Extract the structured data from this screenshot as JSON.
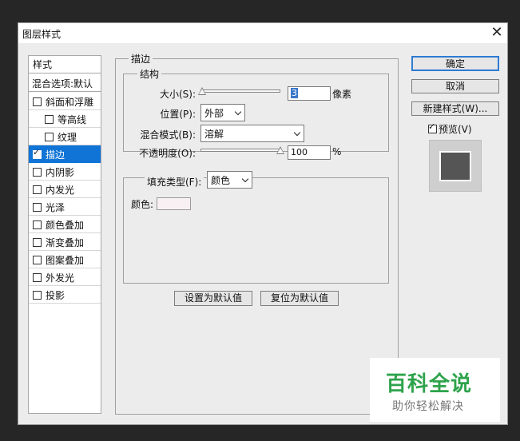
{
  "window": {
    "title": "图层样式",
    "close": "✕"
  },
  "stylelist": {
    "header": "样式",
    "blend_options": "混合选项:默认",
    "items": [
      {
        "label": "斜面和浮雕",
        "checked": false
      },
      {
        "label": "等高线",
        "checked": false
      },
      {
        "label": "纹理",
        "checked": false
      },
      {
        "label": "描边",
        "checked": true
      },
      {
        "label": "内阴影",
        "checked": false
      },
      {
        "label": "内发光",
        "checked": false
      },
      {
        "label": "光泽",
        "checked": false
      },
      {
        "label": "颜色叠加",
        "checked": false
      },
      {
        "label": "渐变叠加",
        "checked": false
      },
      {
        "label": "图案叠加",
        "checked": false
      },
      {
        "label": "外发光",
        "checked": false
      },
      {
        "label": "投影",
        "checked": false
      }
    ],
    "selected": "描边"
  },
  "stroke": {
    "section_title": "描边",
    "structure_title": "结构",
    "size_label": "大小(S):",
    "size_value": "3",
    "size_unit": "像素",
    "size_fraction": 0.02,
    "position_label": "位置(P):",
    "position_value": "外部",
    "blend_label": "混合模式(B):",
    "blend_value": "溶解",
    "opacity_label": "不透明度(O):",
    "opacity_value": "100",
    "opacity_unit": "%",
    "opacity_fraction": 1.0,
    "fill_type_label": "填充类型(F):",
    "fill_type_value": "颜色",
    "color_label": "颜色:",
    "color_value": "#f8f0f2",
    "set_default": "设置为默认值",
    "reset_default": "复位为默认值"
  },
  "buttons": {
    "ok": "确定",
    "cancel": "取消",
    "new_style": "新建样式(W)...",
    "preview_label": "预览(V)",
    "preview_checked": true
  },
  "preview": {
    "swatch_color": "#555555"
  },
  "watermark": {
    "line1": "百科全说",
    "line2": "助你轻松解决"
  }
}
